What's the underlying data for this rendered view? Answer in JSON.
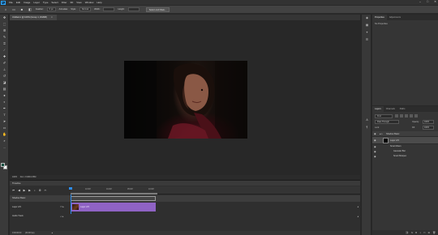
{
  "app": {
    "logo": "Ps"
  },
  "menubar": {
    "items": [
      "File",
      "Edit",
      "Image",
      "Layer",
      "Type",
      "Select",
      "Filter",
      "3D",
      "View",
      "Window",
      "Help"
    ],
    "window_controls": [
      "–",
      "□",
      "✕"
    ]
  },
  "options_bar": {
    "feather_label": "Feather:",
    "feather_value": "0 px",
    "antialias": "Anti-alias",
    "style_label": "Style:",
    "style_value": "Normal",
    "width_label": "Width:",
    "height_label": "Height:",
    "select_mask_button": "Select and Mask..."
  },
  "document": {
    "tab_title": "Untitled-1 @ 100% (Group 1, RGB/8)",
    "status_zoom": "100%",
    "status_info": "Doc: 2.64M/1.68M"
  },
  "timeline": {
    "title": "Timeline",
    "ruler_ticks": [
      "10:00f",
      "01:00f",
      "05:00f",
      "10:00f"
    ],
    "group_label": "Shadow Basic",
    "layer_label": "Layer 2/3",
    "clip_label": "Layer 2/3",
    "audio_label": "Audio Track",
    "timecode": "0:00:00:00",
    "fps": "(30.00 fps)"
  },
  "properties_panel": {
    "tabs": [
      "Properties",
      "Adjustments"
    ],
    "active_tab": "Properties",
    "empty_text": "No Properties"
  },
  "collapsed_strip_tabs": [
    "Color",
    "Swatches"
  ],
  "layers_panel": {
    "tabs": [
      "Layers",
      "Channels",
      "Paths"
    ],
    "active_tab": "Layers",
    "search": "Kind",
    "blend_mode": "Pass Through",
    "opacity_label": "Opacity:",
    "opacity_value": "100%",
    "lock_label": "Lock:",
    "fill_label": "Fill:",
    "fill_value": "100%",
    "layers": [
      {
        "name": "Shadow Basic",
        "kind": "group"
      },
      {
        "name": "Layer 2/3",
        "kind": "layer"
      },
      {
        "name": "Smart Filters",
        "kind": "effects"
      },
      {
        "name": "Gaussian Blur",
        "kind": "filter"
      },
      {
        "name": "Smart Sharpen",
        "kind": "filter"
      }
    ]
  },
  "colors": {
    "foreground_swatch": "#0c4f3f",
    "background_swatch": "#ffffff",
    "clip_color": "#8f63c4",
    "playhead_color": "#2d8ceb",
    "accent": "#31a8ff"
  },
  "icons": {
    "toolbar": [
      "move-icon",
      "marquee-icon",
      "lasso-icon",
      "quick-select-icon",
      "crop-icon",
      "eyedropper-icon",
      "healing-brush-icon",
      "brush-icon",
      "clone-stamp-icon",
      "history-brush-icon",
      "eraser-icon",
      "gradient-icon",
      "blur-icon",
      "dodge-icon",
      "pen-icon",
      "type-icon",
      "path-select-icon",
      "rectangle-icon",
      "hand-icon",
      "zoom-icon",
      "more-tools-icon"
    ]
  }
}
